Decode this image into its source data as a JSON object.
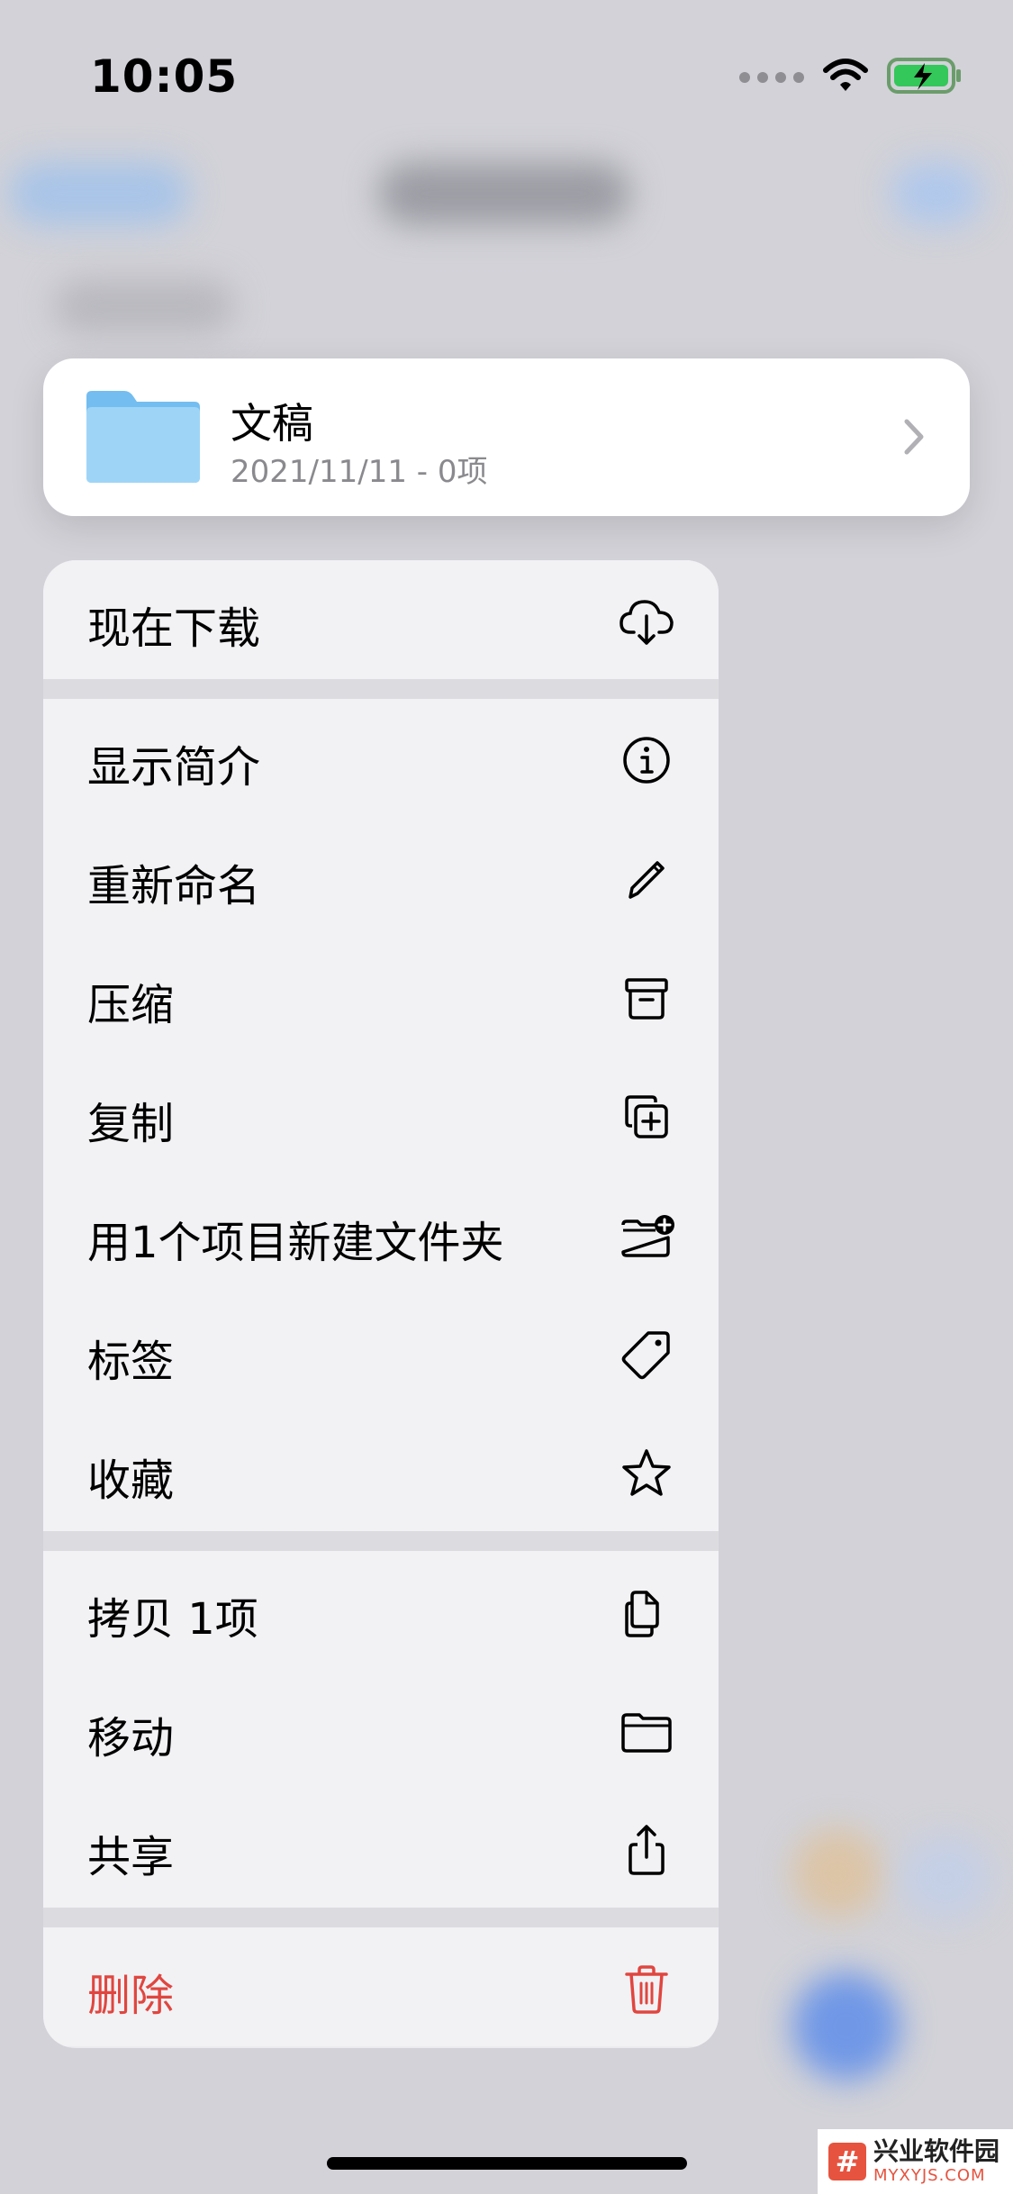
{
  "status_bar": {
    "time": "10:05"
  },
  "folder": {
    "name": "文稿",
    "meta": "2021/11/11 - 0项"
  },
  "menu": {
    "download": "现在下载",
    "get_info": "显示简介",
    "rename": "重新命名",
    "compress": "压缩",
    "duplicate": "复制",
    "new_folder": "用1个项目新建文件夹",
    "tags": "标签",
    "favorite": "收藏",
    "copy": "拷贝 1项",
    "move": "移动",
    "share": "共享",
    "delete": "删除"
  },
  "icons": {
    "download": "cloud-download-icon",
    "get_info": "info-icon",
    "rename": "pencil-icon",
    "compress": "archive-box-icon",
    "duplicate": "duplicate-icon",
    "new_folder": "folder-badge-plus-icon",
    "tags": "tag-icon",
    "favorite": "star-icon",
    "copy": "copy-doc-icon",
    "move": "folder-icon",
    "share": "share-icon",
    "delete": "trash-icon"
  },
  "colors": {
    "destructive": "#e0463f",
    "folder": "#8ecff5",
    "battery": "#34c759"
  },
  "watermark": {
    "main": "兴业软件园",
    "sub": "MYXYJS.COM"
  }
}
